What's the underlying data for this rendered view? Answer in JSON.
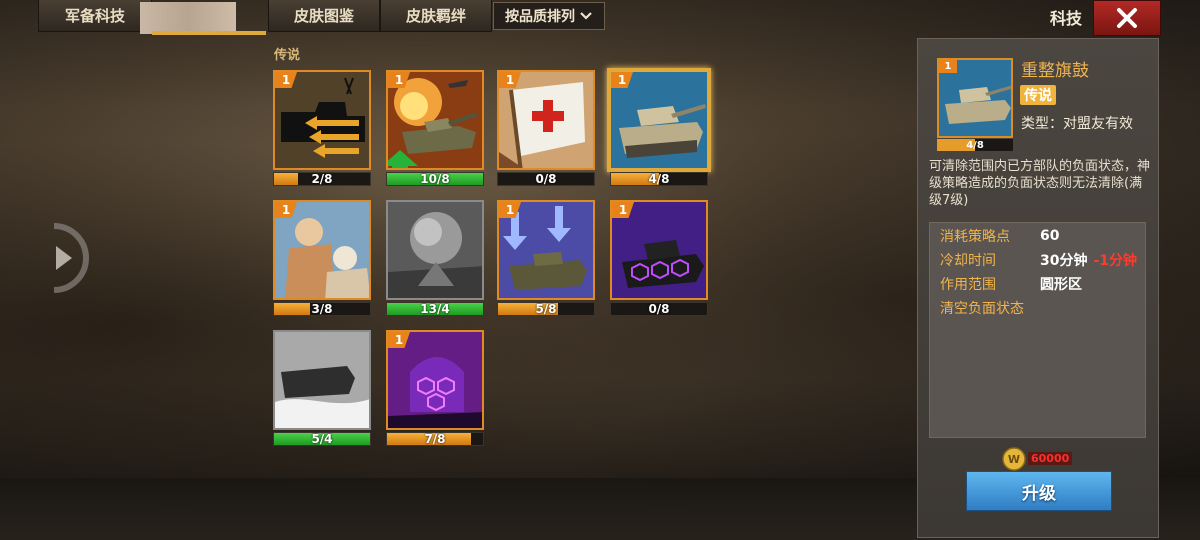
{
  "tabs": [
    {
      "label": "军备科技"
    },
    {
      "label": "皮肤图鉴"
    },
    {
      "label": "皮肤羁绊"
    }
  ],
  "sort_button": {
    "label": "按品质排列"
  },
  "header_title": "科技",
  "section_title": "传说",
  "cards": [
    {
      "level": "1",
      "progress": "2/8",
      "fraction": 0.25,
      "color": "orange"
    },
    {
      "level": "1",
      "progress": "10/8",
      "fraction": 1.0,
      "color": "green"
    },
    {
      "level": "1",
      "progress": "0/8",
      "fraction": 0.0,
      "color": "orange"
    },
    {
      "level": "1",
      "progress": "4/8",
      "fraction": 0.5,
      "color": "orange"
    },
    {
      "level": "1",
      "progress": "3/8",
      "fraction": 0.375,
      "color": "orange"
    },
    {
      "level": "",
      "progress": "13/4",
      "fraction": 1.0,
      "color": "green"
    },
    {
      "level": "1",
      "progress": "5/8",
      "fraction": 0.625,
      "color": "orange"
    },
    {
      "level": "1",
      "progress": "0/8",
      "fraction": 0.0,
      "color": "orange"
    },
    {
      "level": "",
      "progress": "5/4",
      "fraction": 1.0,
      "color": "green"
    },
    {
      "level": "1",
      "progress": "7/8",
      "fraction": 0.875,
      "color": "orange"
    }
  ],
  "detail": {
    "level": "1",
    "progress": "4/8",
    "fraction": 0.5,
    "name": "重整旗鼓",
    "quality": "传说",
    "type": "类型：对盟友有效",
    "description": "可清除范围内已方部队的负面状态，神级策略造成的负面状态则无法清除(满级7级)",
    "stats": [
      {
        "label": "消耗策略点",
        "value": "60",
        "extra": ""
      },
      {
        "label": "冷却时间",
        "value": "30分钟",
        "extra": "-1分钟"
      },
      {
        "label": "作用范围",
        "value": "圆形区",
        "extra": ""
      },
      {
        "label": "清空负面状态",
        "value": "",
        "extra": ""
      }
    ],
    "cost": "60000",
    "upgrade_label": "升级"
  }
}
